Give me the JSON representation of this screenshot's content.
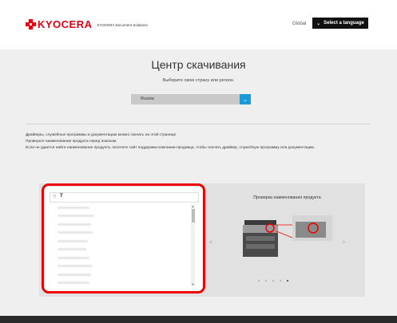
{
  "header": {
    "logo_text": "KYOCERA",
    "logo_sub": "KYOCERA Document Solutions",
    "global_label": "Global",
    "language_button": "Select a language"
  },
  "main": {
    "title": "Центр скачивания",
    "subtitle": "Выберите свою страну или регион.",
    "country_select": {
      "value": "Russia"
    },
    "description": [
      "Драйверы, служебные программы и документацию можно скачать на этой странице.",
      "Проверьте наименование продукта перед поиском.",
      "Если не удается найти наименование продукта, посетите сайт поддержки компании-продавца, чтобы скачать драйвер, служебную программу или документацию."
    ]
  },
  "search": {
    "query": "T",
    "results_count_visible": 11
  },
  "promo": {
    "title": "Проверка наименования продукта",
    "slide_count": 5,
    "active_slide": 4
  },
  "colors": {
    "brand_red": "#e60012",
    "accent_blue": "#1a9bd7",
    "highlight_red": "#ee0000"
  }
}
